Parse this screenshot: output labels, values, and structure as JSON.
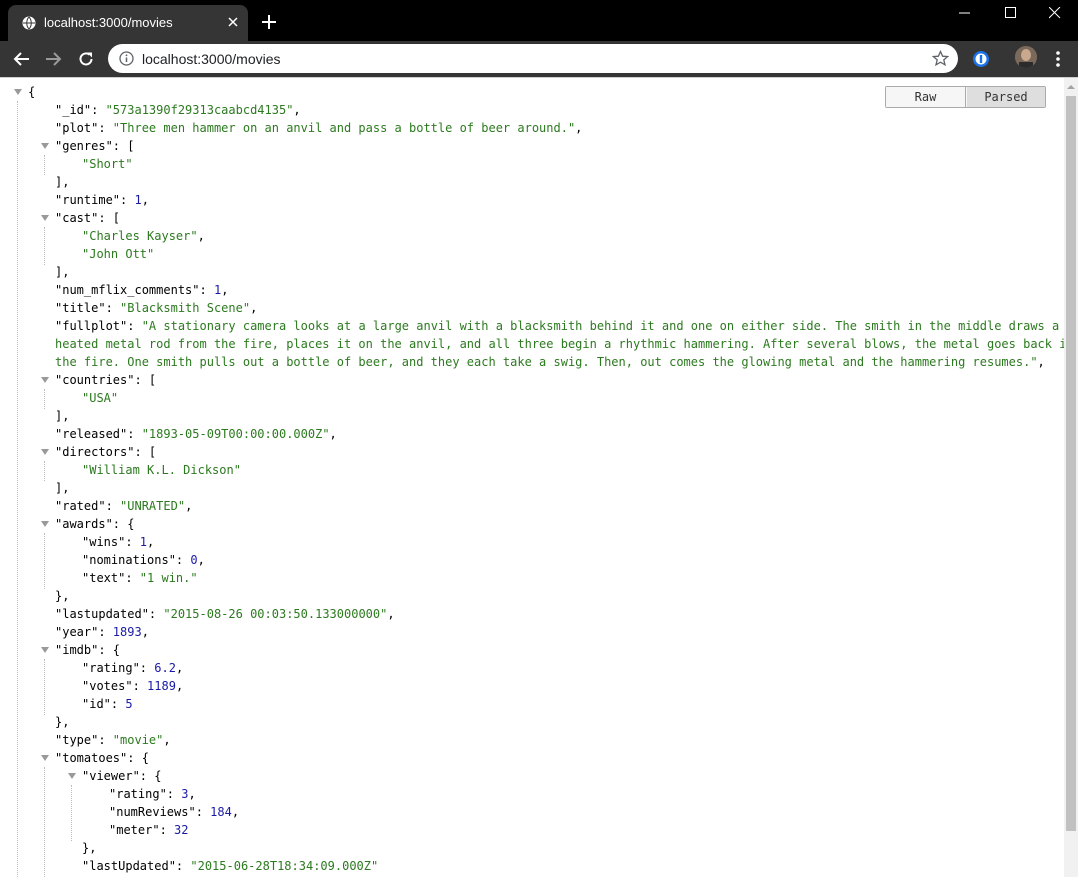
{
  "tab": {
    "title": "localhost:3000/movies",
    "globe_icon": "globe-icon",
    "close_icon": "close-icon"
  },
  "window_controls": {
    "minimize_icon": "minimize-icon",
    "maximize_icon": "maximize-icon",
    "close_icon": "window-close-icon"
  },
  "toolbar": {
    "url": "localhost:3000/movies",
    "back_icon": "back-arrow-icon",
    "forward_icon": "forward-arrow-icon",
    "reload_icon": "reload-icon"
  },
  "viewer": {
    "raw_label": "Raw",
    "parsed_label": "Parsed",
    "active": "Parsed"
  },
  "colors": {
    "string": "#2c7a1f",
    "number": "#1a1aa6",
    "key": "#000000"
  },
  "movie": {
    "_id": "573a1390f29313caabcd4135",
    "plot": "Three men hammer on an anvil and pass a bottle of beer around.",
    "genres": [
      "Short"
    ],
    "runtime": 1,
    "cast": [
      "Charles Kayser",
      "John Ott"
    ],
    "num_mflix_comments": 1,
    "title": "Blacksmith Scene",
    "fullplot": "A stationary camera looks at a large anvil with a blacksmith behind it and one on either side. The smith in the middle draws a heated metal rod from the fire, places it on the anvil, and all three begin a rhythmic hammering. After several blows, the metal goes back in the fire. One smith pulls out a bottle of beer, and they each take a swig. Then, out comes the glowing metal and the hammering resumes.",
    "countries": [
      "USA"
    ],
    "released": "1893-05-09T00:00:00.000Z",
    "directors": [
      "William K.L. Dickson"
    ],
    "rated": "UNRATED",
    "awards": {
      "wins": 1,
      "nominations": 0,
      "text": "1 win."
    },
    "lastupdated": "2015-08-26 00:03:50.133000000",
    "year": 1893,
    "imdb": {
      "rating": 6.2,
      "votes": 1189,
      "id": 5
    },
    "type": "movie",
    "tomatoes": {
      "viewer": {
        "rating": 3,
        "numReviews": 184,
        "meter": 32
      },
      "lastUpdated": "2015-06-28T18:34:09.000Z"
    }
  }
}
